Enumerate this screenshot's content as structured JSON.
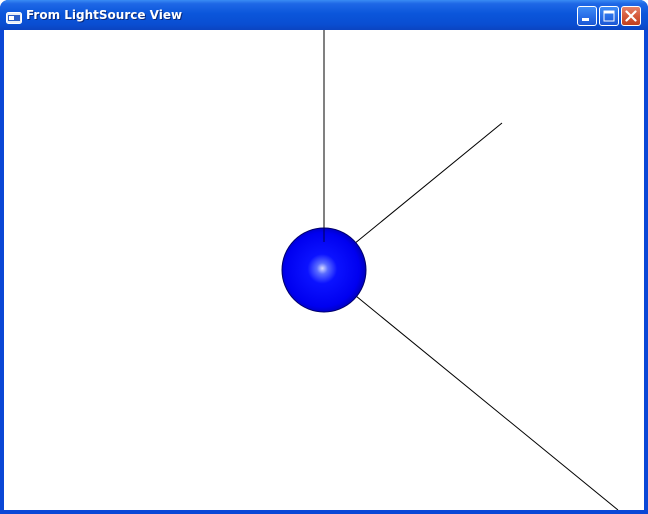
{
  "window": {
    "title": "From LightSource View",
    "buttons": {
      "minimize": "minimize",
      "maximize": "maximize",
      "close": "close"
    }
  },
  "scene": {
    "background_color": "#ffffff",
    "sphere_color": "#0000ff",
    "highlight_color": "#aab8ff",
    "line_color": "#000000"
  }
}
